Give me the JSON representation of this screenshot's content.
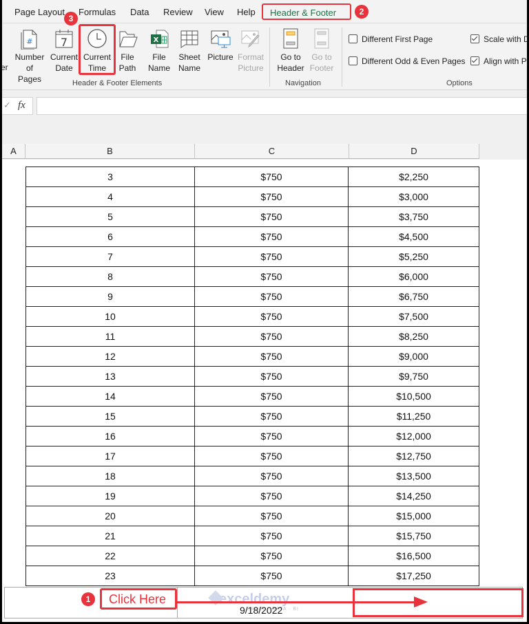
{
  "tabs": [
    {
      "label": "Page Layout"
    },
    {
      "label": "Formulas"
    },
    {
      "label": "Data"
    },
    {
      "label": "Review"
    },
    {
      "label": "View"
    },
    {
      "label": "Help"
    },
    {
      "label": "Header & Footer",
      "active": true
    }
  ],
  "ribbon": {
    "elements_group": {
      "label": "Header & Footer Elements",
      "cut_label": "er",
      "buttons": [
        {
          "line1": "Number",
          "line2": "of Pages",
          "icon": "page-number-icon"
        },
        {
          "line1": "Current",
          "line2": "Date",
          "icon": "calendar-icon",
          "glyph": "7"
        },
        {
          "line1": "Current",
          "line2": "Time",
          "icon": "clock-icon"
        },
        {
          "line1": "File",
          "line2": "Path",
          "icon": "folder-icon"
        },
        {
          "line1": "File",
          "line2": "Name",
          "icon": "excel-file-icon",
          "glyph": "X"
        },
        {
          "line1": "Sheet",
          "line2": "Name",
          "icon": "sheet-grid-icon"
        },
        {
          "line1": "Picture",
          "line2": "",
          "icon": "picture-icon"
        },
        {
          "line1": "Format",
          "line2": "Picture",
          "icon": "format-picture-icon",
          "disabled": true
        }
      ]
    },
    "navigation_group": {
      "label": "Navigation",
      "buttons": [
        {
          "line1": "Go to",
          "line2": "Header",
          "icon": "go-to-header-icon"
        },
        {
          "line1": "Go to",
          "line2": "Footer",
          "icon": "go-to-footer-icon",
          "disabled": true
        }
      ]
    },
    "options_group": {
      "label": "Options",
      "checkboxes": [
        {
          "label": "Different First Page",
          "checked": false
        },
        {
          "label": "Different Odd & Even Pages",
          "checked": false
        },
        {
          "label": "Scale with D",
          "checked": true
        },
        {
          "label": "Align with P",
          "checked": true
        }
      ]
    }
  },
  "formula_bar": {
    "check_glyph": "✓",
    "fx_label": "fx",
    "value": ""
  },
  "columns": [
    "A",
    "B",
    "C",
    "D"
  ],
  "rows": [
    [
      "3",
      "$750",
      "$2,250"
    ],
    [
      "4",
      "$750",
      "$3,000"
    ],
    [
      "5",
      "$750",
      "$3,750"
    ],
    [
      "6",
      "$750",
      "$4,500"
    ],
    [
      "7",
      "$750",
      "$5,250"
    ],
    [
      "8",
      "$750",
      "$6,000"
    ],
    [
      "9",
      "$750",
      "$6,750"
    ],
    [
      "10",
      "$750",
      "$7,500"
    ],
    [
      "11",
      "$750",
      "$8,250"
    ],
    [
      "12",
      "$750",
      "$9,000"
    ],
    [
      "13",
      "$750",
      "$9,750"
    ],
    [
      "14",
      "$750",
      "$10,500"
    ],
    [
      "15",
      "$750",
      "$11,250"
    ],
    [
      "16",
      "$750",
      "$12,000"
    ],
    [
      "17",
      "$750",
      "$12,750"
    ],
    [
      "18",
      "$750",
      "$13,500"
    ],
    [
      "19",
      "$750",
      "$14,250"
    ],
    [
      "20",
      "$750",
      "$15,000"
    ],
    [
      "21",
      "$750",
      "$15,750"
    ],
    [
      "22",
      "$750",
      "$16,500"
    ],
    [
      "23",
      "$750",
      "$17,250"
    ]
  ],
  "footer": {
    "center_text": "9/18/2022",
    "watermark": "exceldemy",
    "watermark_sub": "EXCEL · DATA · BI"
  },
  "annotations": {
    "step1_badge": "1",
    "step1_label": "Click Here",
    "step2_badge": "2",
    "step3_badge": "3",
    "color": "#e8323c"
  }
}
